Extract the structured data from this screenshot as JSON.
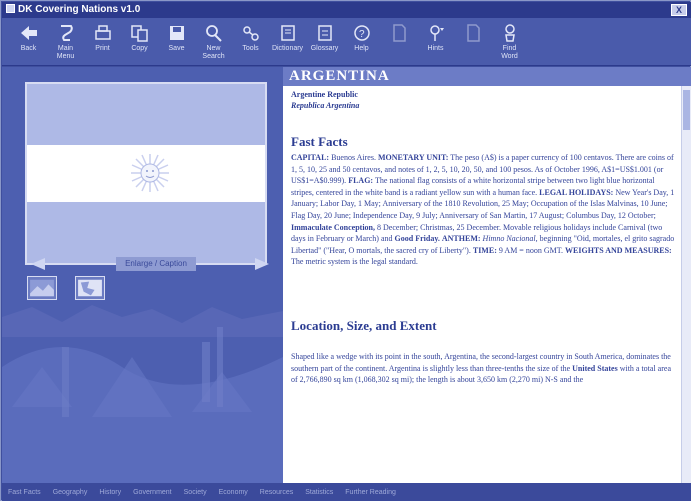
{
  "window": {
    "title": "DK Covering Nations v1.0",
    "close_label": "X"
  },
  "toolbar": [
    {
      "id": "back",
      "label": "Back",
      "icon": "back-arrow-icon",
      "enabled": true
    },
    {
      "id": "main-menu",
      "label": "Main\nMenu",
      "icon": "main-menu-icon",
      "enabled": true
    },
    {
      "id": "print",
      "label": "Print",
      "icon": "printer-icon",
      "enabled": true
    },
    {
      "id": "copy",
      "label": "Copy",
      "icon": "copy-icon",
      "enabled": true
    },
    {
      "id": "save",
      "label": "Save",
      "icon": "disk-icon",
      "enabled": true
    },
    {
      "id": "new-search",
      "label": "New\nSearch",
      "icon": "magnifier-icon",
      "enabled": true
    },
    {
      "id": "tools",
      "label": "Tools",
      "icon": "tools-icon",
      "enabled": true
    },
    {
      "id": "dictionary",
      "label": "Dictionary",
      "icon": "dictionary-icon",
      "enabled": true
    },
    {
      "id": "glossary",
      "label": "Glossary",
      "icon": "glossary-icon",
      "enabled": true
    },
    {
      "id": "help",
      "label": "Help",
      "icon": "help-icon",
      "enabled": true
    },
    {
      "id": "document",
      "label": "",
      "icon": "document-icon",
      "enabled": false
    },
    {
      "id": "hints",
      "label": "Hints",
      "icon": "hints-icon",
      "enabled": true
    },
    {
      "id": "blank",
      "label": "",
      "icon": "page-icon",
      "enabled": false
    },
    {
      "id": "find-word",
      "label": "Find\nWord",
      "icon": "find-word-icon",
      "enabled": true
    }
  ],
  "media": {
    "caption": "Enlarge / Caption"
  },
  "country": {
    "name": "ARGENTINA",
    "official_name": "Argentine Republic",
    "native_name": "Republica Argentina"
  },
  "sections": {
    "fast_facts": {
      "title": "Fast Facts",
      "capital_label": "CAPITAL:",
      "capital": "Buenos Aires.",
      "currency_label": "MONETARY UNIT:",
      "currency": "The peso (A$) is a paper currency of 100 centavos. There are coins of 1, 5, 10, 25 and 50 centavos, and notes of 1, 2, 5, 10, 20, 50, and 100 pesos. As of October 1996, A$1=US$1.001 (or US$1=A$0.999).",
      "flag_label": "FLAG:",
      "flag": "The national flag consists of a white horizontal stripe between two light blue horizontal stripes, centered in the white band is a radiant yellow sun with a human face.",
      "holidays_label": "LEGAL HOLIDAYS:",
      "holidays": "New Year's Day, 1 January; Labor Day, 1 May; Anniversary of the 1810 Revolution, 25 May; Occupation of the Islas Malvinas, 10 June; Flag Day, 20 June; Independence Day, 9 July; Anniversary of San Martin, 17 August; Columbus Day, 12 October;",
      "immaculate_label": "Immaculate Conception,",
      "holidays_cont": "8 December; Christmas, 25 December. Movable religious holidays include Carnival (two days in February or March) and",
      "good_friday_label": "Good Friday.",
      "anthem_label": "ANTHEM:",
      "anthem_title": "Himno Nacional,",
      "anthem_rest": "beginning \"Oid, mortales, el grito sagrado Libertad\" (\"Hear, O mortals, the sacred cry of Liberty\").",
      "time_label": "TIME:",
      "time": "9 AM = noon GMT.",
      "weights_label": "WEIGHTS AND MEASURES:",
      "weights": "The metric system is the legal standard."
    },
    "location": {
      "title": "Location, Size, and Extent",
      "text_start": "Shaped like a wedge with its point in the south, Argentina, the second-largest country in South America, dominates the southern part of the continent. Argentina is slightly less than three-tenths the size of the",
      "us_label": "United States",
      "text_end": "with a total area of 2,766,890 sq km (1,068,302 sq mi); the length is about 3,650 km (2,270 mi) N-S and the"
    }
  },
  "bottom_tabs": [
    "Fast Facts",
    "Geography",
    "History",
    "Government",
    "Society",
    "Economy",
    "Resources",
    "Statistics",
    "Further Reading"
  ]
}
